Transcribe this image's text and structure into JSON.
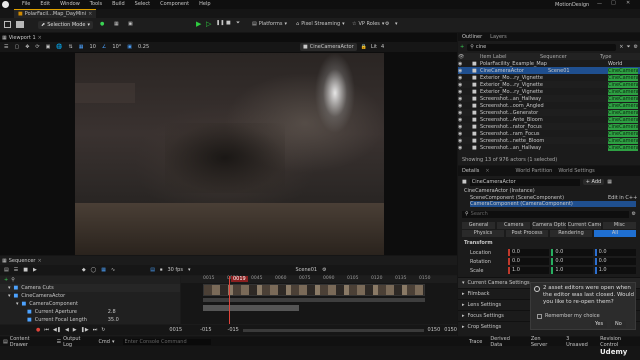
{
  "menubar": {
    "items": [
      "File",
      "Edit",
      "Window",
      "Tools",
      "Build",
      "Select",
      "Component",
      "Help"
    ],
    "project_name": "MotionDesign"
  },
  "tabbar": {
    "tab_label": "PolarFacil...Map_DayMini"
  },
  "toolbar": {
    "mode_label": "Selection Mode",
    "platforms_label": "Platforms",
    "pixel_streaming_label": "Pixel Streaming",
    "vp_roles_label": "VP Roles"
  },
  "viewport": {
    "tab_label": "Viewport 1",
    "grid_value": "10",
    "angle_value": "10°",
    "scale_value": "0.25",
    "camera_label": "CineCameraActor",
    "lit_label": "Lit",
    "fov_label": "4"
  },
  "outliner": {
    "tab_label": "Outliner",
    "layers_tab": "Layers",
    "search_value": "cine",
    "columns": [
      "Item Label",
      "Sequencer",
      "Type"
    ],
    "rows": [
      {
        "label": "PolarFacility_Example_Map",
        "seq": "",
        "type": "World",
        "tag": false
      },
      {
        "label": "CineCameraActor",
        "seq": "Scene01",
        "type": "CineCamera",
        "tag": true,
        "selected": true
      },
      {
        "label": "Exterior_Mo...ry_Vignette",
        "seq": "",
        "type": "CineCamera",
        "tag": true
      },
      {
        "label": "Exterior_Mo...ry_Vignette",
        "seq": "",
        "type": "CineCamera",
        "tag": true
      },
      {
        "label": "Exterior_Mo...ry_Vignette",
        "seq": "",
        "type": "CineCamera",
        "tag": true
      },
      {
        "label": "Screenshot...an_Hallway",
        "seq": "",
        "type": "CineCamera",
        "tag": true
      },
      {
        "label": "Screenshot...oom_Angled",
        "seq": "",
        "type": "CineCamera",
        "tag": true
      },
      {
        "label": "Screenshot...Generator",
        "seq": "",
        "type": "CineCamera",
        "tag": true
      },
      {
        "label": "Screenshot...Ante_Bloom",
        "seq": "",
        "type": "CineCamera",
        "tag": true
      },
      {
        "label": "Screenshot...rator_Focus",
        "seq": "",
        "type": "CineCamera",
        "tag": true
      },
      {
        "label": "Screenshot...ram_Focus",
        "seq": "",
        "type": "CineCamera",
        "tag": true
      },
      {
        "label": "Screenshot...nette_Bloom",
        "seq": "",
        "type": "CineCamera",
        "tag": true
      },
      {
        "label": "Screenshot...an_Hallway",
        "seq": "",
        "type": "CineCamera",
        "tag": true
      }
    ],
    "status": "Showing 13 of 976 actors (1 selected)"
  },
  "details": {
    "tab_label": "Details",
    "world_partition_tab": "World Partition",
    "world_settings_tab": "World Settings",
    "actor_name": "CineCameraActor",
    "add_label": "+ Add",
    "instance_label": "CineCameraActor (Instance)",
    "scene_component": "SceneComponent (SceneComponent)",
    "camera_component": "CameraComponent (CameraComponent)",
    "edit_in_cpp": "Edit in C++",
    "search_placeholder": "Search",
    "filter_tabs_row1": [
      "General",
      "Camera",
      "Camera Options",
      "Current Camera Settings",
      "Misc"
    ],
    "filter_tabs_row2": [
      "Physics",
      "Post Process",
      "Rendering",
      "All"
    ],
    "transform_header": "Transform",
    "location_label": "Location",
    "rotation_label": "Rotation",
    "scale_label": "Scale",
    "location_values": [
      "0.0",
      "0.0",
      "0.0"
    ],
    "rotation_values": [
      "0.0",
      "0.0",
      "0.0"
    ],
    "scale_values": [
      "1.0",
      "1.0",
      "1.0"
    ],
    "sections": [
      "Current Camera Settings",
      "Filmback",
      "Lens Settings",
      "Focus Settings",
      "Crop Settings"
    ]
  },
  "notification": {
    "message": "2 asset editors were open when the editor was last closed. Would you like to re-open them?",
    "remember_label": "Remember my choice",
    "yes_label": "Yes",
    "no_label": "No"
  },
  "sequencer": {
    "tab_label": "Sequencer",
    "fps_label": "30 fps",
    "scene_label": "Scene01",
    "playhead_frame": "0019",
    "tracks": [
      {
        "label": "Camera Cuts",
        "indent": 0
      },
      {
        "label": "CineCameraActor",
        "indent": 0
      },
      {
        "label": "CameraComponent",
        "indent": 1
      },
      {
        "label": "Current Aperture",
        "indent": 2,
        "value": "2.8"
      },
      {
        "label": "Current Focal Length",
        "indent": 2,
        "value": "35.0"
      }
    ],
    "ruler_ticks": [
      "0015",
      "0030",
      "0045",
      "0060",
      "0075",
      "0090",
      "0105",
      "0120",
      "0135",
      "0150"
    ],
    "bottom_start": "0015",
    "bottom_ticks": [
      "-015",
      "-015",
      "0015",
      "0030"
    ],
    "bottom_end": "0150",
    "bottom_end2": "0150"
  },
  "statusbar": {
    "content_drawer": "Content Drawer",
    "output_log": "Output Log",
    "cmd_label": "Cmd",
    "console_placeholder": "Enter Console Command",
    "trace_label": "Trace",
    "derived_data_label": "Derived Data",
    "zen_server_label": "Zen Server",
    "unsaved_label": "3 Unsaved",
    "revision_control_label": "Revision Control"
  },
  "watermark": "Udemy"
}
